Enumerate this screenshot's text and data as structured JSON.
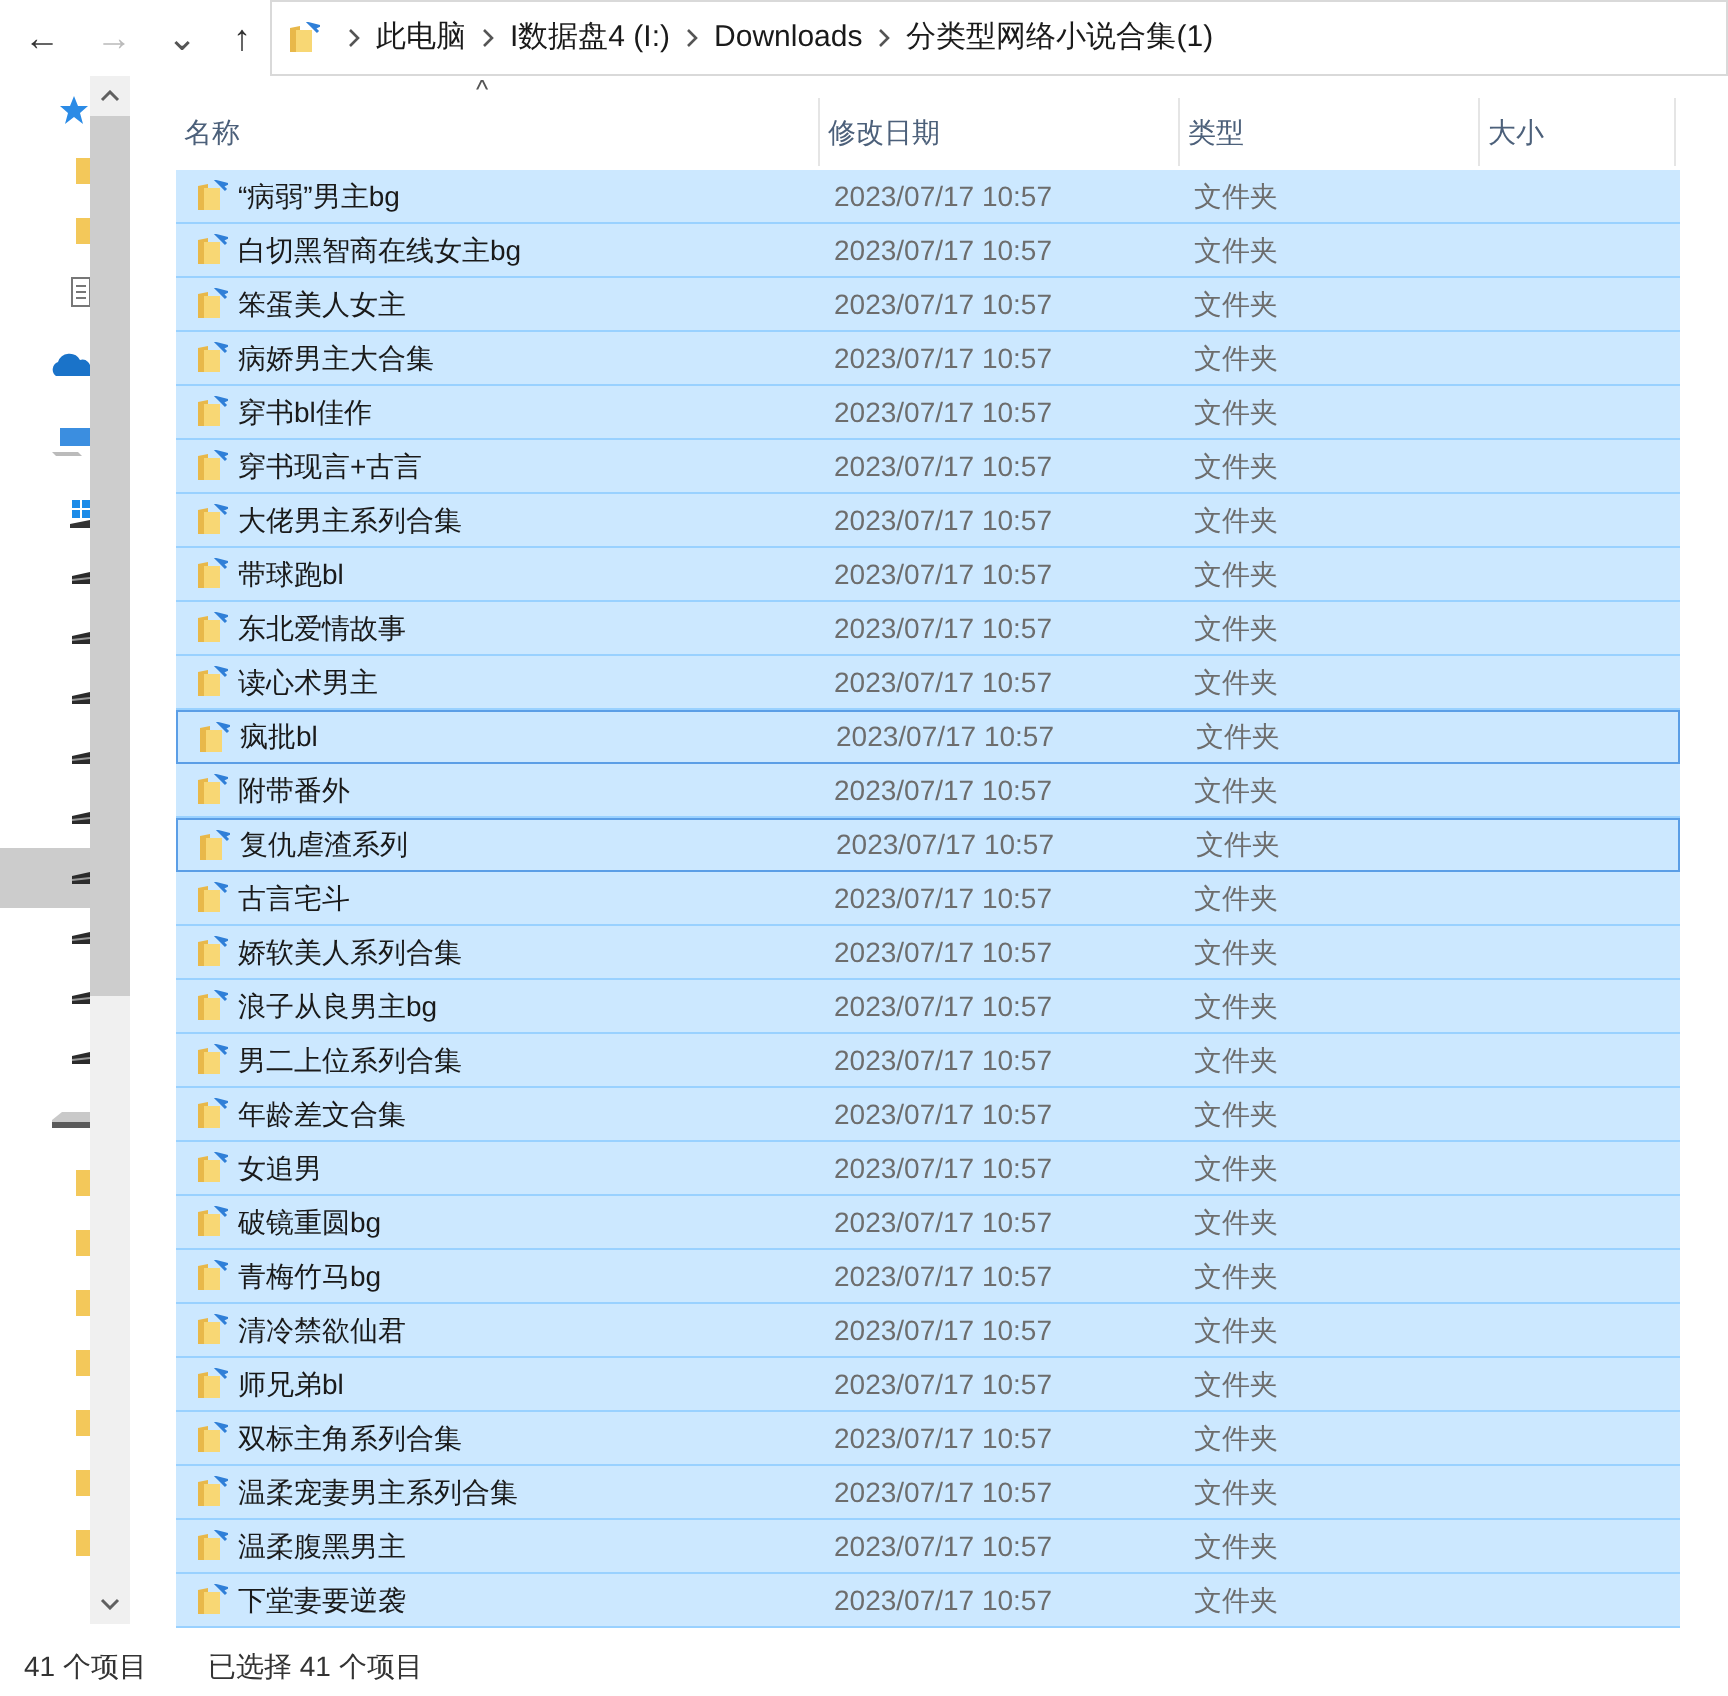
{
  "toolbar": {
    "back": "←",
    "forward": "→",
    "recent": "⌄",
    "up": "↑"
  },
  "address_bar": {
    "crumbs": [
      "此电脑",
      "I数据盘4 (I:)",
      "Downloads",
      "分类型网络小说合集(1)"
    ]
  },
  "sidebar": {
    "items": [
      {
        "kind": "star",
        "selected": false
      },
      {
        "kind": "folder",
        "selected": false
      },
      {
        "kind": "folder",
        "selected": false
      },
      {
        "kind": "document",
        "selected": false
      },
      {
        "kind": "cloud",
        "selected": false
      },
      {
        "kind": "computer",
        "selected": false
      },
      {
        "kind": "windows-drive",
        "selected": false
      },
      {
        "kind": "drive",
        "selected": false
      },
      {
        "kind": "drive",
        "selected": false
      },
      {
        "kind": "drive",
        "selected": false
      },
      {
        "kind": "drive",
        "selected": false
      },
      {
        "kind": "drive",
        "selected": false
      },
      {
        "kind": "drive",
        "selected": true
      },
      {
        "kind": "drive",
        "selected": false
      },
      {
        "kind": "drive",
        "selected": false
      },
      {
        "kind": "drive",
        "selected": false
      },
      {
        "kind": "network-drive",
        "selected": false
      },
      {
        "kind": "folder",
        "selected": false
      },
      {
        "kind": "folder",
        "selected": false
      },
      {
        "kind": "folder",
        "selected": false
      },
      {
        "kind": "folder",
        "selected": false
      },
      {
        "kind": "folder",
        "selected": false
      },
      {
        "kind": "folder",
        "selected": false
      },
      {
        "kind": "folder",
        "selected": false
      }
    ]
  },
  "table": {
    "sort_arrow": "^",
    "columns": [
      "名称",
      "修改日期",
      "类型",
      "大小"
    ],
    "rows": [
      {
        "name": "“病弱”男主bg",
        "date": "2023/07/17 10:57",
        "type": "文件夹",
        "selected": true,
        "focused": false
      },
      {
        "name": "白切黑智商在线女主bg",
        "date": "2023/07/17 10:57",
        "type": "文件夹",
        "selected": true,
        "focused": false
      },
      {
        "name": "笨蛋美人女主",
        "date": "2023/07/17 10:57",
        "type": "文件夹",
        "selected": true,
        "focused": false
      },
      {
        "name": "病娇男主大合集",
        "date": "2023/07/17 10:57",
        "type": "文件夹",
        "selected": true,
        "focused": false
      },
      {
        "name": "穿书bl佳作",
        "date": "2023/07/17 10:57",
        "type": "文件夹",
        "selected": true,
        "focused": false
      },
      {
        "name": "穿书现言+古言",
        "date": "2023/07/17 10:57",
        "type": "文件夹",
        "selected": true,
        "focused": false
      },
      {
        "name": "大佬男主系列合集",
        "date": "2023/07/17 10:57",
        "type": "文件夹",
        "selected": true,
        "focused": false
      },
      {
        "name": "带球跑bl",
        "date": "2023/07/17 10:57",
        "type": "文件夹",
        "selected": true,
        "focused": false
      },
      {
        "name": "东北爱情故事",
        "date": "2023/07/17 10:57",
        "type": "文件夹",
        "selected": true,
        "focused": false
      },
      {
        "name": "读心术男主",
        "date": "2023/07/17 10:57",
        "type": "文件夹",
        "selected": true,
        "focused": false
      },
      {
        "name": "疯批bl",
        "date": "2023/07/17 10:57",
        "type": "文件夹",
        "selected": true,
        "focused": true
      },
      {
        "name": "附带番外",
        "date": "2023/07/17 10:57",
        "type": "文件夹",
        "selected": true,
        "focused": false
      },
      {
        "name": "复仇虐渣系列",
        "date": "2023/07/17 10:57",
        "type": "文件夹",
        "selected": true,
        "focused": true
      },
      {
        "name": "古言宅斗",
        "date": "2023/07/17 10:57",
        "type": "文件夹",
        "selected": true,
        "focused": false
      },
      {
        "name": "娇软美人系列合集",
        "date": "2023/07/17 10:57",
        "type": "文件夹",
        "selected": true,
        "focused": false
      },
      {
        "name": "浪子从良男主bg",
        "date": "2023/07/17 10:57",
        "type": "文件夹",
        "selected": true,
        "focused": false
      },
      {
        "name": "男二上位系列合集",
        "date": "2023/07/17 10:57",
        "type": "文件夹",
        "selected": true,
        "focused": false
      },
      {
        "name": "年龄差文合集",
        "date": "2023/07/17 10:57",
        "type": "文件夹",
        "selected": true,
        "focused": false
      },
      {
        "name": "女追男",
        "date": "2023/07/17 10:57",
        "type": "文件夹",
        "selected": true,
        "focused": false
      },
      {
        "name": "破镜重圆bg",
        "date": "2023/07/17 10:57",
        "type": "文件夹",
        "selected": true,
        "focused": false
      },
      {
        "name": "青梅竹马bg",
        "date": "2023/07/17 10:57",
        "type": "文件夹",
        "selected": true,
        "focused": false
      },
      {
        "name": "清冷禁欲仙君",
        "date": "2023/07/17 10:57",
        "type": "文件夹",
        "selected": true,
        "focused": false
      },
      {
        "name": "师兄弟bl",
        "date": "2023/07/17 10:57",
        "type": "文件夹",
        "selected": true,
        "focused": false
      },
      {
        "name": "双标主角系列合集",
        "date": "2023/07/17 10:57",
        "type": "文件夹",
        "selected": true,
        "focused": false
      },
      {
        "name": "温柔宠妻男主系列合集",
        "date": "2023/07/17 10:57",
        "type": "文件夹",
        "selected": true,
        "focused": false
      },
      {
        "name": "温柔腹黑男主",
        "date": "2023/07/17 10:57",
        "type": "文件夹",
        "selected": true,
        "focused": false
      },
      {
        "name": "下堂妻要逆袭",
        "date": "2023/07/17 10:57",
        "type": "文件夹",
        "selected": true,
        "focused": false
      }
    ]
  },
  "status_bar": {
    "item_count": "41 个项目",
    "selected_count": "已选择 41 个项目"
  }
}
